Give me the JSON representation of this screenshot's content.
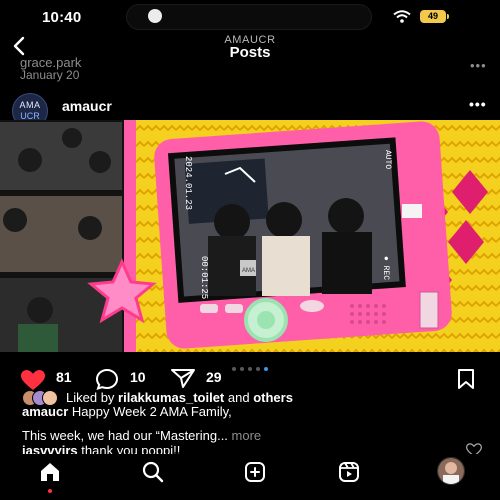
{
  "status_bar": {
    "time": "10:40",
    "battery": "49"
  },
  "header": {
    "username": "AMAUCR",
    "title": "Posts"
  },
  "previous_post": {
    "username": "grace.park",
    "date": "January 20"
  },
  "post": {
    "username": "amaucr",
    "avatar_text_top": "AMA",
    "avatar_text_bottom": "UCR",
    "image": {
      "camera_date": "2024.01.23",
      "camera_time": "00:01:25",
      "rec_label": "● REC",
      "auto_label": "AUTO",
      "photo_badge": "AMA"
    },
    "carousel": {
      "count": 5,
      "active_index": 4
    },
    "likes": "81",
    "comments": "10",
    "shares": "29",
    "liked_by_prefix": "Liked by",
    "liked_by_user": "rilakkumas_toilet",
    "liked_by_and": "and",
    "liked_by_others": "others",
    "caption_user": "amaucr",
    "caption_text": "Happy Week 2 AMA Family,",
    "caption_body": "This week, we had our “Mastering...",
    "more": "more",
    "comment_user": "jasvvyirs",
    "comment_text": "thank you poppi!!"
  },
  "colors": {
    "accent_like": "#ff3040",
    "pink": "#ff5fa8",
    "yellow": "#f5d11f",
    "link_blue": "#3897f0"
  },
  "icons": [
    "wifi-icon",
    "back-chevron-icon",
    "heart-icon",
    "comment-icon",
    "share-icon",
    "bookmark-icon",
    "home-icon",
    "search-icon",
    "create-icon",
    "reels-icon"
  ]
}
